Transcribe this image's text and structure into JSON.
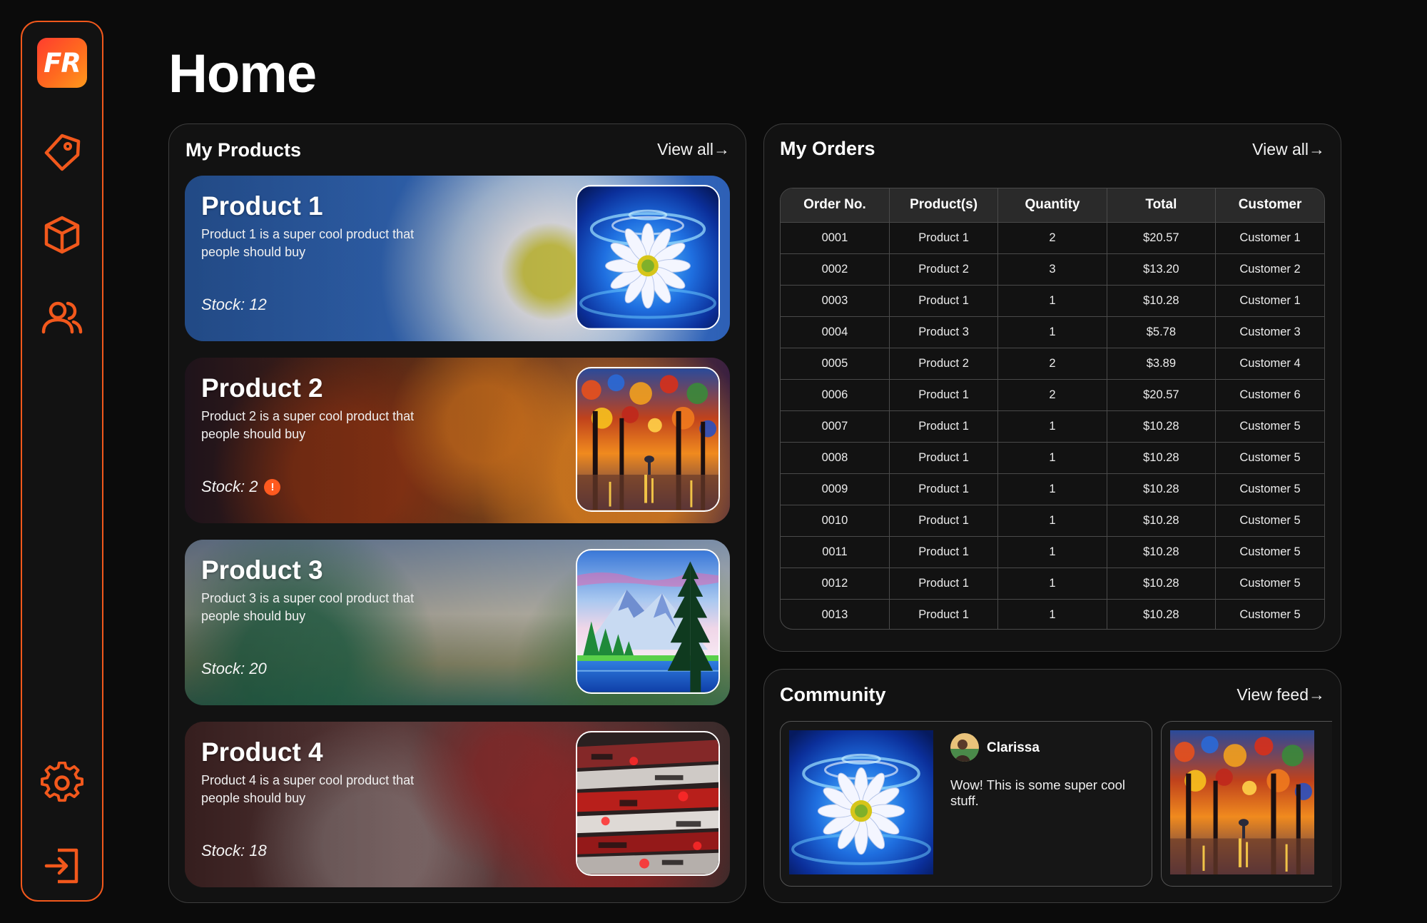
{
  "app": {
    "logo_text": "FR",
    "accent": "#f2581c"
  },
  "sidebar": {
    "items": [
      {
        "icon": "tag-icon"
      },
      {
        "icon": "box-icon"
      },
      {
        "icon": "users-icon"
      },
      {
        "icon": "gear-icon"
      },
      {
        "icon": "logout-icon"
      }
    ]
  },
  "page": {
    "title": "Home"
  },
  "products": {
    "title": "My Products",
    "view_all": "View all→",
    "items": [
      {
        "name": "Product 1",
        "description": "Product 1 is a super cool product that people should buy",
        "stock": "Stock: 12",
        "low_stock": false
      },
      {
        "name": "Product 2",
        "description": "Product 2 is a super cool product that people should buy",
        "stock": "Stock: 2",
        "low_stock": true
      },
      {
        "name": "Product 3",
        "description": "Product 3 is a super cool product that people should buy",
        "stock": "Stock: 20",
        "low_stock": false
      },
      {
        "name": "Product 4",
        "description": "Product 4 is a super cool product that people should buy",
        "stock": "Stock: 18",
        "low_stock": false
      }
    ]
  },
  "orders": {
    "title": "My Orders",
    "view_all": "View all→",
    "columns": [
      "Order No.",
      "Product(s)",
      "Quantity",
      "Total",
      "Customer"
    ],
    "rows": [
      [
        "0001",
        "Product 1",
        "2",
        "$20.57",
        "Customer 1"
      ],
      [
        "0002",
        "Product 2",
        "3",
        "$13.20",
        "Customer 2"
      ],
      [
        "0003",
        "Product 1",
        "1",
        "$10.28",
        "Customer 1"
      ],
      [
        "0004",
        "Product 3",
        "1",
        "$5.78",
        "Customer 3"
      ],
      [
        "0005",
        "Product 2",
        "2",
        "$3.89",
        "Customer 4"
      ],
      [
        "0006",
        "Product 1",
        "2",
        "$20.57",
        "Customer 6"
      ],
      [
        "0007",
        "Product 1",
        "1",
        "$10.28",
        "Customer 5"
      ],
      [
        "0008",
        "Product 1",
        "1",
        "$10.28",
        "Customer 5"
      ],
      [
        "0009",
        "Product 1",
        "1",
        "$10.28",
        "Customer 5"
      ],
      [
        "0010",
        "Product 1",
        "1",
        "$10.28",
        "Customer 5"
      ],
      [
        "0011",
        "Product 1",
        "1",
        "$10.28",
        "Customer 5"
      ],
      [
        "0012",
        "Product 1",
        "1",
        "$10.28",
        "Customer 5"
      ],
      [
        "0013",
        "Product 1",
        "1",
        "$10.28",
        "Customer 5"
      ]
    ]
  },
  "community": {
    "title": "Community",
    "view_feed": "View feed→",
    "posts": [
      {
        "user": "Clarissa",
        "text": "Wow! This is some super cool stuff."
      }
    ]
  }
}
